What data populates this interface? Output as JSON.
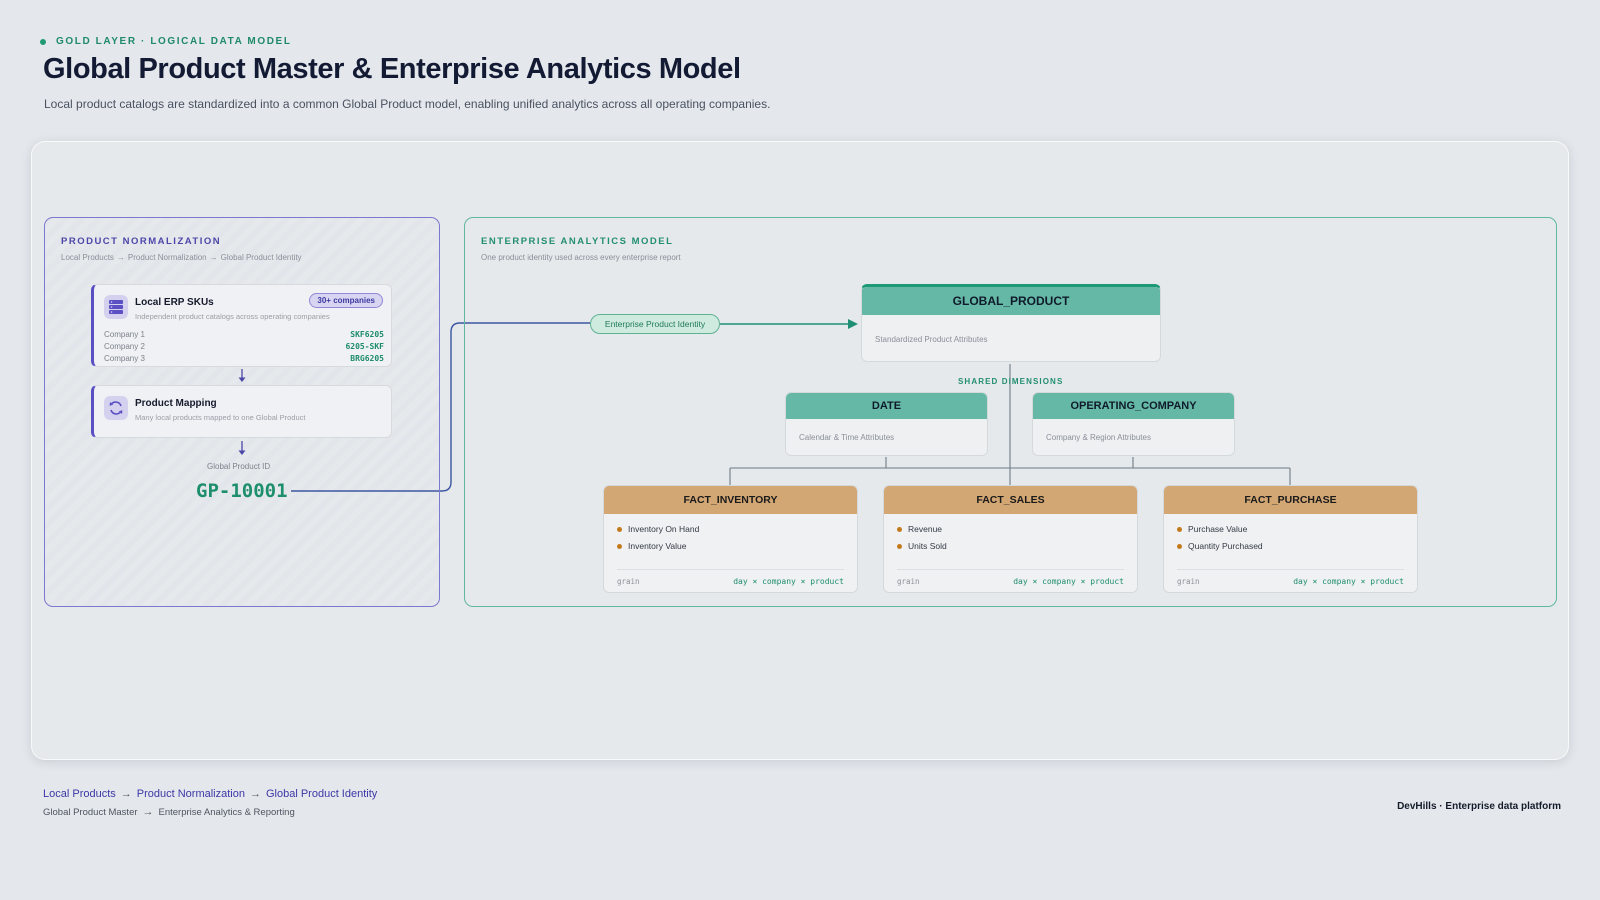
{
  "header": {
    "eyebrow": "GOLD LAYER · LOGICAL DATA MODEL",
    "title": "Global Product Master & Enterprise Analytics Model",
    "subtitle": "Local product catalogs are standardized into a common Global Product model, enabling unified analytics across all operating companies."
  },
  "normalization": {
    "title": "PRODUCT NORMALIZATION",
    "caption": [
      "Local Products",
      "Product Normalization",
      "Global Product Identity"
    ],
    "erp": {
      "title": "Local ERP SKUs",
      "badge": "30+ companies",
      "subtitle": "Independent product catalogs across operating companies",
      "icon": "server-stack-icon",
      "rows": [
        {
          "company": "Company 1",
          "sku": "SKF6205"
        },
        {
          "company": "Company 2",
          "sku": "6205-SKF"
        },
        {
          "company": "Company 3",
          "sku": "BRG6205"
        }
      ]
    },
    "mapping": {
      "title": "Product Mapping",
      "subtitle": "Many local products mapped to one Global Product",
      "icon": "sync-icon"
    },
    "global_id": {
      "label": "Global Product ID",
      "value": "GP-10001"
    }
  },
  "analytics": {
    "title": "ENTERPRISE ANALYTICS MODEL",
    "caption": "One product identity used across every enterprise report",
    "pill": "Enterprise Product Identity",
    "global_product": {
      "name": "GLOBAL_PRODUCT",
      "desc": "Standardized Product Attributes"
    },
    "shared_label": "SHARED DIMENSIONS",
    "dimensions": [
      {
        "name": "DATE",
        "desc": "Calendar & Time Attributes"
      },
      {
        "name": "OPERATING_COMPANY",
        "desc": "Company & Region Attributes"
      }
    ],
    "facts": [
      {
        "name": "FACT_INVENTORY",
        "measures": [
          "Inventory On Hand",
          "Inventory Value"
        ],
        "grain_key": "grain",
        "grain": "day × company × product"
      },
      {
        "name": "FACT_SALES",
        "measures": [
          "Revenue",
          "Units Sold"
        ],
        "grain_key": "grain",
        "grain": "day × company × product"
      },
      {
        "name": "FACT_PURCHASE",
        "measures": [
          "Purchase Value",
          "Quantity Purchased"
        ],
        "grain_key": "grain",
        "grain": "day × company × product"
      }
    ]
  },
  "footer": {
    "flow": [
      "Local Products",
      "Product Normalization",
      "Global Product Identity"
    ],
    "sub": [
      "Global Product Master",
      "Enterprise Analytics & Reporting"
    ],
    "brand": "DevHills · Enterprise data platform"
  },
  "colors": {
    "accent_purple": "#5a50c4",
    "accent_teal": "#1f9a78",
    "dimension_header": "#66b8a6",
    "fact_header": "#d3a774",
    "connector": "#6f7b86"
  }
}
